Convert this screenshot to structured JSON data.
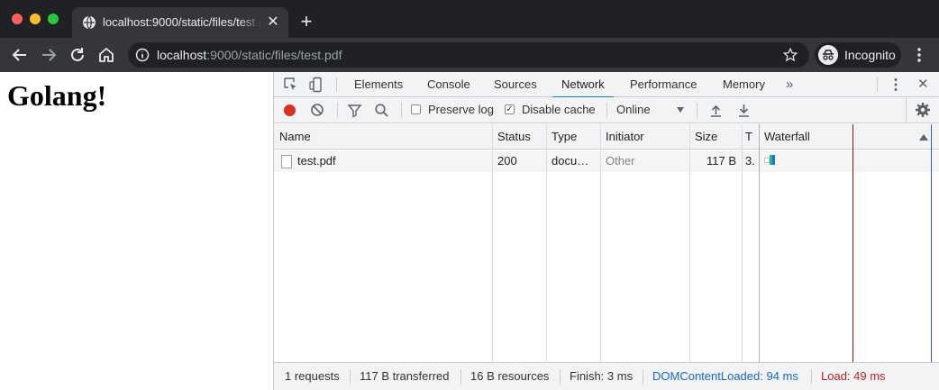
{
  "browser": {
    "tab": {
      "title": "localhost:9000/static/files/test.pdf",
      "close_glyph": "✕",
      "icon": "globe-icon"
    },
    "new_tab_glyph": "+",
    "address": {
      "host": "localhost",
      "rest": ":9000/static/files/test.pdf"
    },
    "profile_label": "Incognito"
  },
  "page": {
    "heading": "Golang!"
  },
  "devtools": {
    "tabs": [
      "Elements",
      "Console",
      "Sources",
      "Network",
      "Performance",
      "Memory"
    ],
    "active_tab": "Network",
    "more_tabs_glyph": "»",
    "close_glyph": "✕",
    "toolbar": {
      "preserve_log": {
        "label": "Preserve log",
        "checked": false
      },
      "disable_cache": {
        "label": "Disable cache",
        "checked": true,
        "mark": "✓"
      },
      "throttling": "Online"
    },
    "columns": [
      "Name",
      "Status",
      "Type",
      "Initiator",
      "Size",
      "T",
      "Waterfall"
    ],
    "rows": [
      {
        "name": "test.pdf",
        "status": "200",
        "type": "docu…",
        "initiator": "Other",
        "size": "117 B",
        "time": "3."
      }
    ],
    "summary": {
      "requests": "1 requests",
      "transferred": "117 B transferred",
      "resources": "16 B resources",
      "finish": "Finish: 3 ms",
      "dom_content_loaded": "DOMContentLoaded: 94 ms",
      "load": "Load: 49 ms"
    },
    "colors": {
      "accent": "#1a73e8",
      "record": "#d93025",
      "dcl_line": "#1967d2",
      "load_line": "#a50e0e"
    }
  }
}
